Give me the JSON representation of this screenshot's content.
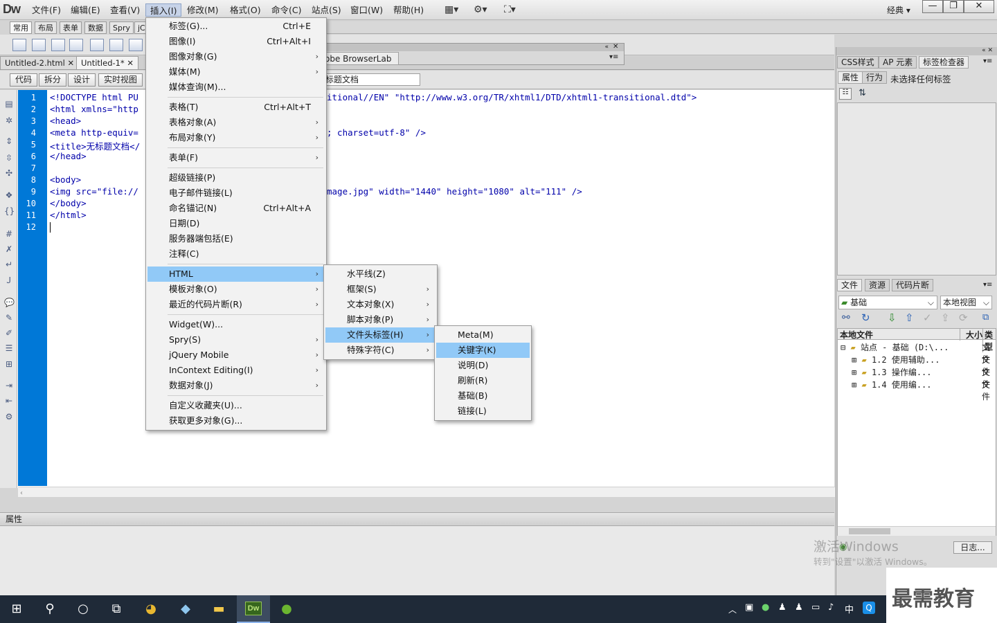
{
  "app": {
    "logo": "Dw",
    "layout_mode": "经典",
    "menus": [
      "文件(F)",
      "编辑(E)",
      "查看(V)",
      "插入(I)",
      "修改(M)",
      "格式(O)",
      "命令(C)",
      "站点(S)",
      "窗口(W)",
      "帮助(H)"
    ],
    "window_buttons": [
      "—",
      "❐",
      "✕"
    ]
  },
  "insert_tabs": [
    "常用",
    "布局",
    "表单",
    "数据",
    "Spry",
    "jC"
  ],
  "doc_tabs": [
    "Untitled-2.html",
    "Untitled-1*"
  ],
  "browserlab_title": "obe BrowserLab",
  "view_buttons": [
    "代码",
    "拆分",
    "设计",
    "实时视图"
  ],
  "doc_title_value": "标题文档",
  "code": {
    "line_numbers": [
      "1",
      "2",
      "3",
      "4",
      "5",
      "6",
      "7",
      "8",
      "9",
      "10",
      "11",
      "12"
    ],
    "lines": [
      "<!DOCTYPE html PU",
      "<html xmlns=\"http",
      "<head>",
      "<meta http-equiv=",
      "<title>无标题文档</",
      "</head>",
      "",
      "<body>",
      "<img src=\"file://",
      "</body>",
      "</html>",
      ""
    ],
    "line1_tail": "itional//EN\" \"http://www.w3.org/TR/xhtml1/DTD/xhtml1-transitional.dtd\">",
    "line4_tail": "; charset=utf-8\" />",
    "line9_tail": "mage.jpg\" width=\"1440\" height=\"1080\" alt=\"111\" />"
  },
  "properties_label": "属性",
  "right_panel": {
    "tabs_top": [
      "CSS样式",
      "AP 元素",
      "标签检查器"
    ],
    "sub_tabs": [
      "属性",
      "行为"
    ],
    "no_tag_text": "未选择任何标签",
    "tabs_files": [
      "文件",
      "资源",
      "代码片断"
    ],
    "site_select": "基础",
    "view_select": "本地视图",
    "file_headers": [
      "本地文件",
      "大小",
      "类型"
    ],
    "tree": [
      {
        "label": "站点 - 基础 (D:\\...",
        "type": "文件"
      },
      {
        "label": "1.2 使用辅助...",
        "type": "文件"
      },
      {
        "label": "1.3 操作编...",
        "type": "文件"
      },
      {
        "label": "1.4 使用编...",
        "type": "文件"
      }
    ],
    "log_button": "日志..."
  },
  "insert_menu": [
    {
      "label": "标签(G)...",
      "shortcut": "Ctrl+E"
    },
    {
      "label": "图像(I)",
      "shortcut": "Ctrl+Alt+I"
    },
    {
      "label": "图像对象(G)",
      "submenu": true
    },
    {
      "label": "媒体(M)",
      "submenu": true
    },
    {
      "label": "媒体查询(M)..."
    },
    {
      "label": "表格(T)",
      "shortcut": "Ctrl+Alt+T"
    },
    {
      "label": "表格对象(A)",
      "submenu": true
    },
    {
      "label": "布局对象(Y)",
      "submenu": true
    },
    {
      "label": "表单(F)",
      "submenu": true
    },
    {
      "label": "超级链接(P)"
    },
    {
      "label": "电子邮件链接(L)"
    },
    {
      "label": "命名锚记(N)",
      "shortcut": "Ctrl+Alt+A"
    },
    {
      "label": "日期(D)"
    },
    {
      "label": "服务器端包括(E)"
    },
    {
      "label": "注释(C)"
    },
    {
      "label": "HTML",
      "submenu": true
    },
    {
      "label": "模板对象(O)",
      "submenu": true
    },
    {
      "label": "最近的代码片断(R)",
      "submenu": true
    },
    {
      "label": "Widget(W)..."
    },
    {
      "label": "Spry(S)",
      "submenu": true
    },
    {
      "label": "jQuery Mobile",
      "submenu": true
    },
    {
      "label": "InContext Editing(I)",
      "submenu": true
    },
    {
      "label": "数据对象(J)",
      "submenu": true
    },
    {
      "label": "自定义收藏夹(U)..."
    },
    {
      "label": "获取更多对象(G)..."
    }
  ],
  "html_submenu": [
    {
      "label": "水平线(Z)"
    },
    {
      "label": "框架(S)",
      "submenu": true
    },
    {
      "label": "文本对象(X)",
      "submenu": true
    },
    {
      "label": "脚本对象(P)",
      "submenu": true
    },
    {
      "label": "文件头标签(H)",
      "submenu": true
    },
    {
      "label": "特殊字符(C)",
      "submenu": true
    }
  ],
  "head_submenu": [
    {
      "label": "Meta(M)"
    },
    {
      "label": "关键字(K)"
    },
    {
      "label": "说明(D)"
    },
    {
      "label": "刷新(R)"
    },
    {
      "label": "基础(B)"
    },
    {
      "label": "链接(L)"
    }
  ],
  "windows_watermark": {
    "line1": "激活Windows",
    "line2": "转到\"设置\"以激活 Windows。"
  },
  "brand_watermark": "最需教育",
  "taskbar": {
    "ime": "中",
    "dw_label": "Dw"
  }
}
